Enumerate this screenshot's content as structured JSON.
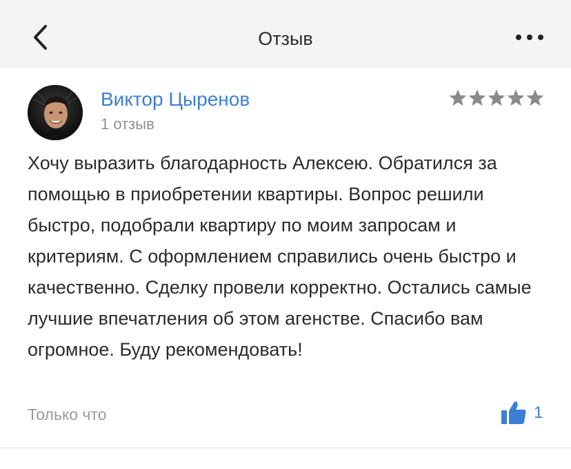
{
  "nav": {
    "title": "Отзыв",
    "back_icon": "chevron-left-icon",
    "more_icon": "more-horizontal-icon"
  },
  "review": {
    "author_name": "Виктор Цыренов",
    "author_meta": "1 отзыв",
    "rating": 5,
    "rating_max": 5,
    "text": "Хочу выразить благодарность Алексею. Обратился за помощью в приобретении квартиры. Вопрос решили быстро, подобрали квартиру по моим запросам и критериям. С оформлением справились очень быстро и качественно. Сделку провели корректно. Остались самые лучшие впечатления об этом агенстве. Спасибо вам огромное. Буду рекомендовать!",
    "timestamp": "Только что",
    "likes": "1"
  },
  "colors": {
    "accent": "#3c7fd4",
    "star": "#8a8a8a",
    "navbar_bg": "#f4f4f4",
    "text": "#2b2b2b",
    "muted": "#9a9a9a"
  }
}
